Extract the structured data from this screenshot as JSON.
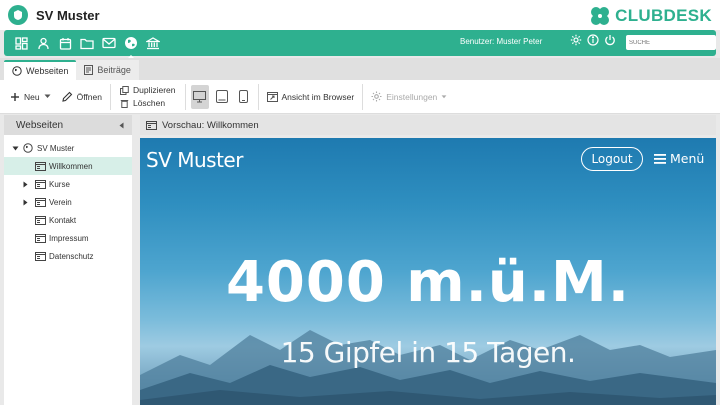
{
  "app": {
    "title": "SV Muster",
    "brand": "CLUBDESK"
  },
  "greenbar": {
    "icons": [
      "dashboard-icon",
      "person-icon",
      "calendar-icon",
      "folder-icon",
      "mail-icon",
      "globe-icon",
      "bank-icon"
    ],
    "user_label": "Benutzer: Muster Peter",
    "search_placeholder": "SUCHE"
  },
  "tabs": [
    {
      "label": "Webseiten",
      "active": true
    },
    {
      "label": "Beiträge",
      "active": false
    }
  ],
  "toolbar": {
    "new_label": "Neu",
    "open_label": "Öffnen",
    "duplicate_label": "Duplizieren",
    "delete_label": "Löschen",
    "browser_label": "Ansicht im Browser",
    "settings_label": "Einstellungen"
  },
  "sidebar": {
    "title": "Webseiten",
    "root": "SV Muster",
    "items": [
      {
        "label": "Willkommen",
        "selected": true,
        "expandable": false
      },
      {
        "label": "Kurse",
        "selected": false,
        "expandable": true
      },
      {
        "label": "Verein",
        "selected": false,
        "expandable": true
      },
      {
        "label": "Kontakt",
        "selected": false,
        "expandable": false
      },
      {
        "label": "Impressum",
        "selected": false,
        "expandable": false
      },
      {
        "label": "Datenschutz",
        "selected": false,
        "expandable": false
      }
    ]
  },
  "preview": {
    "header": "Vorschau: Willkommen",
    "site_title": "SV Muster",
    "logout_label": "Logout",
    "menu_label": "Menü",
    "hero_title": "4000 m.ü.M.",
    "hero_subtitle": "15 Gipfel in 15 Tagen."
  },
  "colors": {
    "accent": "#2eb08f",
    "selected_row": "#d7efe8",
    "sky_top": "#1e7ab0"
  }
}
